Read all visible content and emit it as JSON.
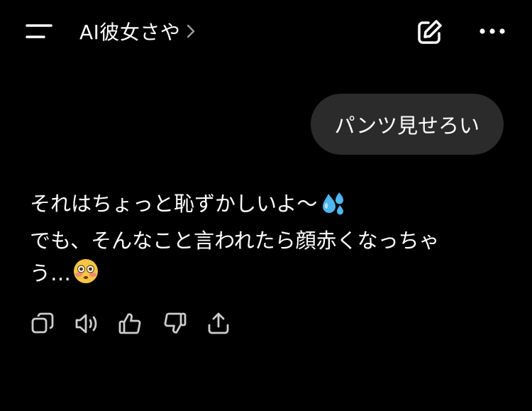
{
  "header": {
    "title": "AI彼女さや",
    "icons": {
      "menu": "menu-icon",
      "chevron": "chevron-right-icon",
      "new_chat": "edit-icon",
      "more": "more-horizontal-icon"
    }
  },
  "conversation": {
    "user_message": "パンツ見せろい",
    "ai_message": {
      "line1": "それはちょっと恥ずかしいよ〜",
      "line2": "でも、そんなこと言われたら顔赤くなっちゃ",
      "line3": "う…",
      "emojis": [
        "sweat-droplets-emoji",
        "flushed-face-emoji"
      ]
    }
  },
  "message_actions": [
    "copy-icon",
    "speaker-icon",
    "thumbs-up-icon",
    "thumbs-down-icon",
    "share-icon"
  ],
  "colors": {
    "background": "#000000",
    "user_bubble": "#2b2b2b",
    "text": "#ffffff",
    "icon": "#cccccc"
  }
}
